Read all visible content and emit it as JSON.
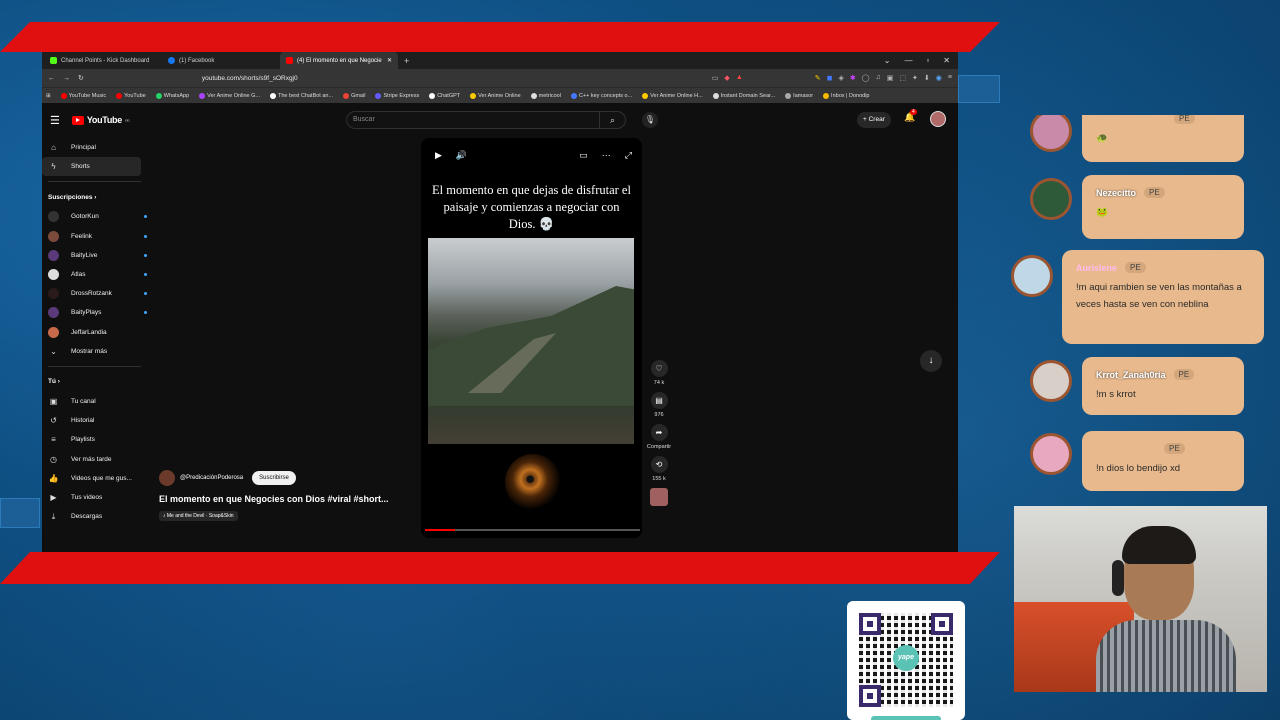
{
  "browser": {
    "tabs": [
      {
        "label": "Channel Points - Kick Dashboard",
        "color": "#53fc18"
      },
      {
        "label": "(1) Facebook",
        "color": "#1877f2"
      },
      {
        "label": "(4) El momento en que Negocie",
        "color": "#ff0000"
      }
    ],
    "new_tab": "+",
    "url": "youtube.com/shorts/s9f_sORxgj0",
    "bookmarks": [
      "YouTube Music",
      "YouTube",
      "WhatsApp",
      "Ver Anime Online G...",
      "The best ChatBot an...",
      "Gmail",
      "Stripe Express",
      "ChatGPT",
      "Ver Anime Online",
      "metricool",
      "C++ key concepts o...",
      "Ver Anime Online H...",
      "Instant Domain Sear...",
      "Iamasor",
      "Inbox | Donodip"
    ]
  },
  "youtube": {
    "logo": "YouTube",
    "region": "PE",
    "search_placeholder": "Buscar",
    "create_label": "Crear",
    "notif_count": "4",
    "sidebar": {
      "main": [
        "Principal",
        "Shorts"
      ],
      "subs_title": "Suscripciones",
      "subs": [
        "GotorKun",
        "Feelink",
        "BaityLive",
        "Atlas",
        "DrossRotzank",
        "BaityPlays",
        "JeffarLandia"
      ],
      "show_more": "Mostrar más",
      "you_title": "Tú",
      "you": [
        "Tu canal",
        "Historial",
        "Playlists",
        "Ver más tarde",
        "Videos que me gus...",
        "Tus videos",
        "Descargas"
      ]
    },
    "short": {
      "caption": "El momento en que dejas de disfrutar el paisaje y comienzas a negociar con Dios. 💀",
      "progress": 0.14,
      "likes": "74 k",
      "comments": "976",
      "share": "Compartir",
      "remix": "155 k",
      "channel": "@PredicaciónPoderosa",
      "subscribe": "Suscribirse",
      "title": "El momento en que Negocies con Dios #viral #short...",
      "song": "♪ Me and the Devil · Soap&Skin"
    }
  },
  "chat": [
    {
      "user": "",
      "badge": "PE",
      "text": "🐢"
    },
    {
      "user": "Nezecitto",
      "badge": "PE",
      "text": "🐸"
    },
    {
      "user": "Aurislene",
      "badge": "PE",
      "text": "!m aqui rambien se ven las montañas a veces hasta se ven con neblina"
    },
    {
      "user": "Krrot_Zanah0ria",
      "badge": "PE",
      "text": "!m s krrot"
    },
    {
      "user": "",
      "badge": "PE",
      "text": "!n dios lo bendijo xd"
    }
  ],
  "qr": {
    "brand": "yape"
  },
  "colors": {
    "band": "#e01010",
    "bubble": "#e8b98c",
    "yt_red": "#ff0000"
  }
}
